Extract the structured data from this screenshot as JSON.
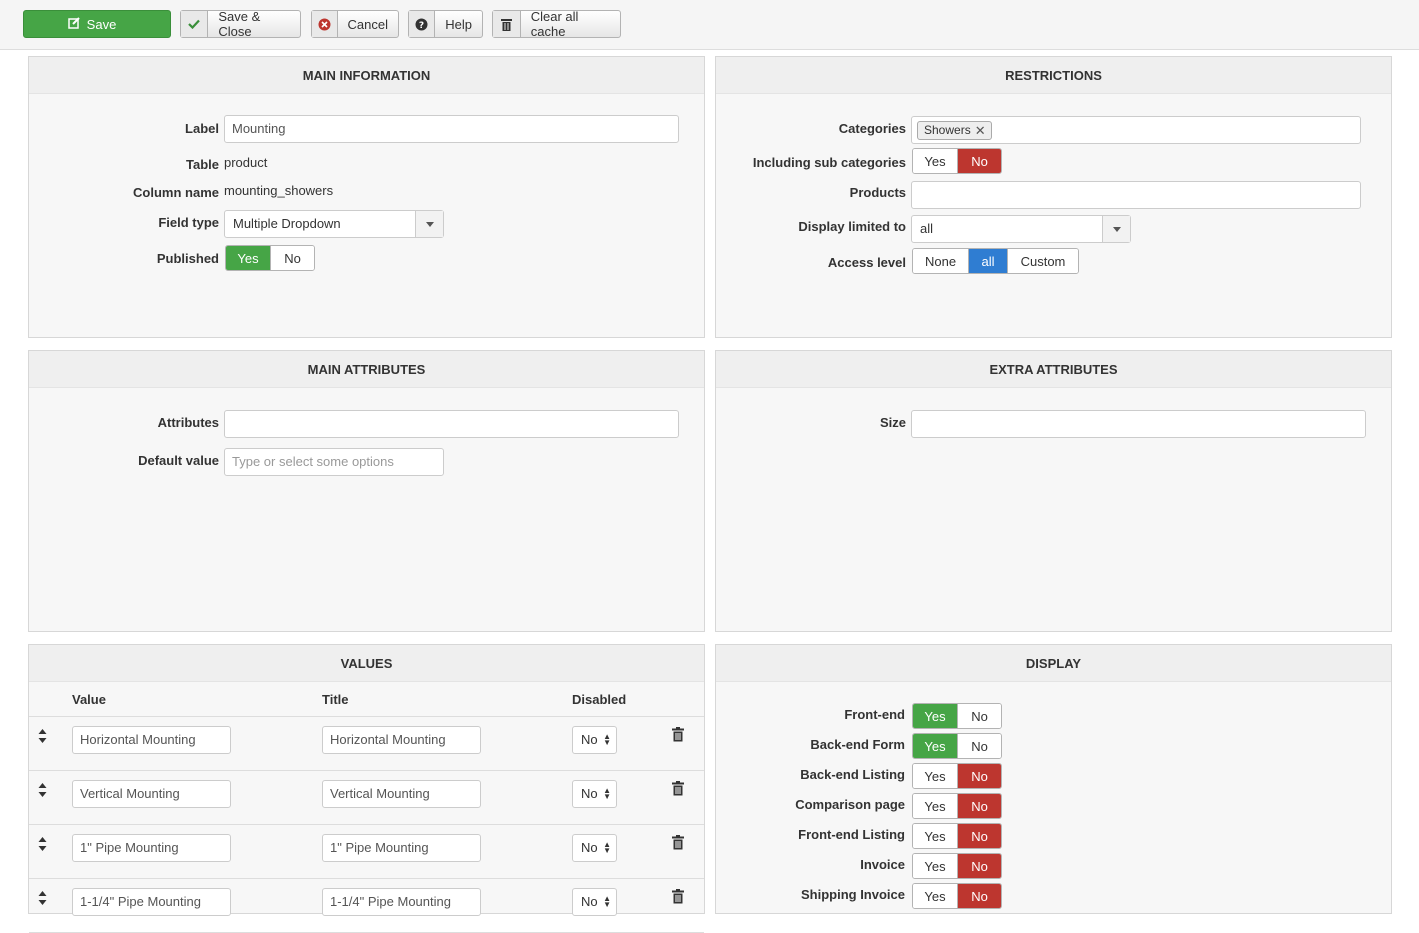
{
  "toolbar": {
    "save": "Save",
    "save_close": "Save & Close",
    "cancel": "Cancel",
    "help": "Help",
    "clear_cache": "Clear all cache"
  },
  "main_info": {
    "title": "MAIN INFORMATION",
    "label_label": "Label",
    "label_value": "Mounting",
    "table_label": "Table",
    "table_value": "product",
    "column_label": "Column name",
    "column_value": "mounting_showers",
    "field_type_label": "Field type",
    "field_type_value": "Multiple Dropdown",
    "published_label": "Published",
    "yes": "Yes",
    "no": "No"
  },
  "restrictions": {
    "title": "RESTRICTIONS",
    "categories_label": "Categories",
    "category_tag": "Showers",
    "sub_label": "Including sub categories",
    "products_label": "Products",
    "display_limited_label": "Display limited to",
    "display_limited_value": "all",
    "access_label": "Access level",
    "access_none": "None",
    "access_all": "all",
    "access_custom": "Custom",
    "yes": "Yes",
    "no": "No"
  },
  "main_attributes": {
    "title": "MAIN ATTRIBUTES",
    "attributes_label": "Attributes",
    "default_label": "Default value",
    "default_placeholder": "Type or select some options"
  },
  "extra_attributes": {
    "title": "EXTRA ATTRIBUTES",
    "size_label": "Size"
  },
  "values": {
    "title": "VALUES",
    "col_value": "Value",
    "col_title": "Title",
    "col_disabled": "Disabled",
    "rows": [
      {
        "value": "Horizontal Mounting",
        "title": "Horizontal Mounting",
        "disabled": "No"
      },
      {
        "value": "Vertical Mounting",
        "title": "Vertical Mounting",
        "disabled": "No"
      },
      {
        "value": "1\" Pipe Mounting",
        "title": "1\" Pipe Mounting",
        "disabled": "No"
      },
      {
        "value": "1-1/4\" Pipe Mounting",
        "title": "1-1/4\" Pipe Mounting",
        "disabled": "No"
      }
    ]
  },
  "display": {
    "title": "DISPLAY",
    "yes": "Yes",
    "no": "No",
    "rows": [
      {
        "label": "Front-end",
        "state": "yes"
      },
      {
        "label": "Back-end Form",
        "state": "yes"
      },
      {
        "label": "Back-end Listing",
        "state": "no"
      },
      {
        "label": "Comparison page",
        "state": "no"
      },
      {
        "label": "Front-end Listing",
        "state": "no"
      },
      {
        "label": "Invoice",
        "state": "no"
      },
      {
        "label": "Shipping Invoice",
        "state": "no"
      }
    ]
  },
  "colors": {
    "green": "#46a546",
    "red": "#bd362f",
    "blue": "#2f7dd2"
  }
}
